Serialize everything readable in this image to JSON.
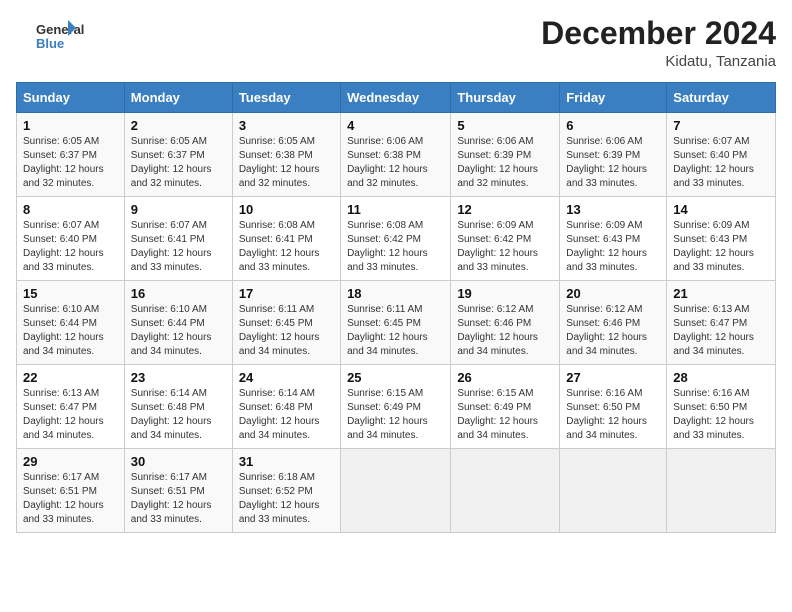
{
  "header": {
    "logo_general": "General",
    "logo_blue": "Blue",
    "month_title": "December 2024",
    "location": "Kidatu, Tanzania"
  },
  "days_of_week": [
    "Sunday",
    "Monday",
    "Tuesday",
    "Wednesday",
    "Thursday",
    "Friday",
    "Saturday"
  ],
  "weeks": [
    [
      {
        "day": "1",
        "sunrise": "6:05 AM",
        "sunset": "6:37 PM",
        "daylight": "12 hours and 32 minutes."
      },
      {
        "day": "2",
        "sunrise": "6:05 AM",
        "sunset": "6:37 PM",
        "daylight": "12 hours and 32 minutes."
      },
      {
        "day": "3",
        "sunrise": "6:05 AM",
        "sunset": "6:38 PM",
        "daylight": "12 hours and 32 minutes."
      },
      {
        "day": "4",
        "sunrise": "6:06 AM",
        "sunset": "6:38 PM",
        "daylight": "12 hours and 32 minutes."
      },
      {
        "day": "5",
        "sunrise": "6:06 AM",
        "sunset": "6:39 PM",
        "daylight": "12 hours and 32 minutes."
      },
      {
        "day": "6",
        "sunrise": "6:06 AM",
        "sunset": "6:39 PM",
        "daylight": "12 hours and 33 minutes."
      },
      {
        "day": "7",
        "sunrise": "6:07 AM",
        "sunset": "6:40 PM",
        "daylight": "12 hours and 33 minutes."
      }
    ],
    [
      {
        "day": "8",
        "sunrise": "6:07 AM",
        "sunset": "6:40 PM",
        "daylight": "12 hours and 33 minutes."
      },
      {
        "day": "9",
        "sunrise": "6:07 AM",
        "sunset": "6:41 PM",
        "daylight": "12 hours and 33 minutes."
      },
      {
        "day": "10",
        "sunrise": "6:08 AM",
        "sunset": "6:41 PM",
        "daylight": "12 hours and 33 minutes."
      },
      {
        "day": "11",
        "sunrise": "6:08 AM",
        "sunset": "6:42 PM",
        "daylight": "12 hours and 33 minutes."
      },
      {
        "day": "12",
        "sunrise": "6:09 AM",
        "sunset": "6:42 PM",
        "daylight": "12 hours and 33 minutes."
      },
      {
        "day": "13",
        "sunrise": "6:09 AM",
        "sunset": "6:43 PM",
        "daylight": "12 hours and 33 minutes."
      },
      {
        "day": "14",
        "sunrise": "6:09 AM",
        "sunset": "6:43 PM",
        "daylight": "12 hours and 33 minutes."
      }
    ],
    [
      {
        "day": "15",
        "sunrise": "6:10 AM",
        "sunset": "6:44 PM",
        "daylight": "12 hours and 34 minutes."
      },
      {
        "day": "16",
        "sunrise": "6:10 AM",
        "sunset": "6:44 PM",
        "daylight": "12 hours and 34 minutes."
      },
      {
        "day": "17",
        "sunrise": "6:11 AM",
        "sunset": "6:45 PM",
        "daylight": "12 hours and 34 minutes."
      },
      {
        "day": "18",
        "sunrise": "6:11 AM",
        "sunset": "6:45 PM",
        "daylight": "12 hours and 34 minutes."
      },
      {
        "day": "19",
        "sunrise": "6:12 AM",
        "sunset": "6:46 PM",
        "daylight": "12 hours and 34 minutes."
      },
      {
        "day": "20",
        "sunrise": "6:12 AM",
        "sunset": "6:46 PM",
        "daylight": "12 hours and 34 minutes."
      },
      {
        "day": "21",
        "sunrise": "6:13 AM",
        "sunset": "6:47 PM",
        "daylight": "12 hours and 34 minutes."
      }
    ],
    [
      {
        "day": "22",
        "sunrise": "6:13 AM",
        "sunset": "6:47 PM",
        "daylight": "12 hours and 34 minutes."
      },
      {
        "day": "23",
        "sunrise": "6:14 AM",
        "sunset": "6:48 PM",
        "daylight": "12 hours and 34 minutes."
      },
      {
        "day": "24",
        "sunrise": "6:14 AM",
        "sunset": "6:48 PM",
        "daylight": "12 hours and 34 minutes."
      },
      {
        "day": "25",
        "sunrise": "6:15 AM",
        "sunset": "6:49 PM",
        "daylight": "12 hours and 34 minutes."
      },
      {
        "day": "26",
        "sunrise": "6:15 AM",
        "sunset": "6:49 PM",
        "daylight": "12 hours and 34 minutes."
      },
      {
        "day": "27",
        "sunrise": "6:16 AM",
        "sunset": "6:50 PM",
        "daylight": "12 hours and 34 minutes."
      },
      {
        "day": "28",
        "sunrise": "6:16 AM",
        "sunset": "6:50 PM",
        "daylight": "12 hours and 33 minutes."
      }
    ],
    [
      {
        "day": "29",
        "sunrise": "6:17 AM",
        "sunset": "6:51 PM",
        "daylight": "12 hours and 33 minutes."
      },
      {
        "day": "30",
        "sunrise": "6:17 AM",
        "sunset": "6:51 PM",
        "daylight": "12 hours and 33 minutes."
      },
      {
        "day": "31",
        "sunrise": "6:18 AM",
        "sunset": "6:52 PM",
        "daylight": "12 hours and 33 minutes."
      },
      null,
      null,
      null,
      null
    ]
  ]
}
